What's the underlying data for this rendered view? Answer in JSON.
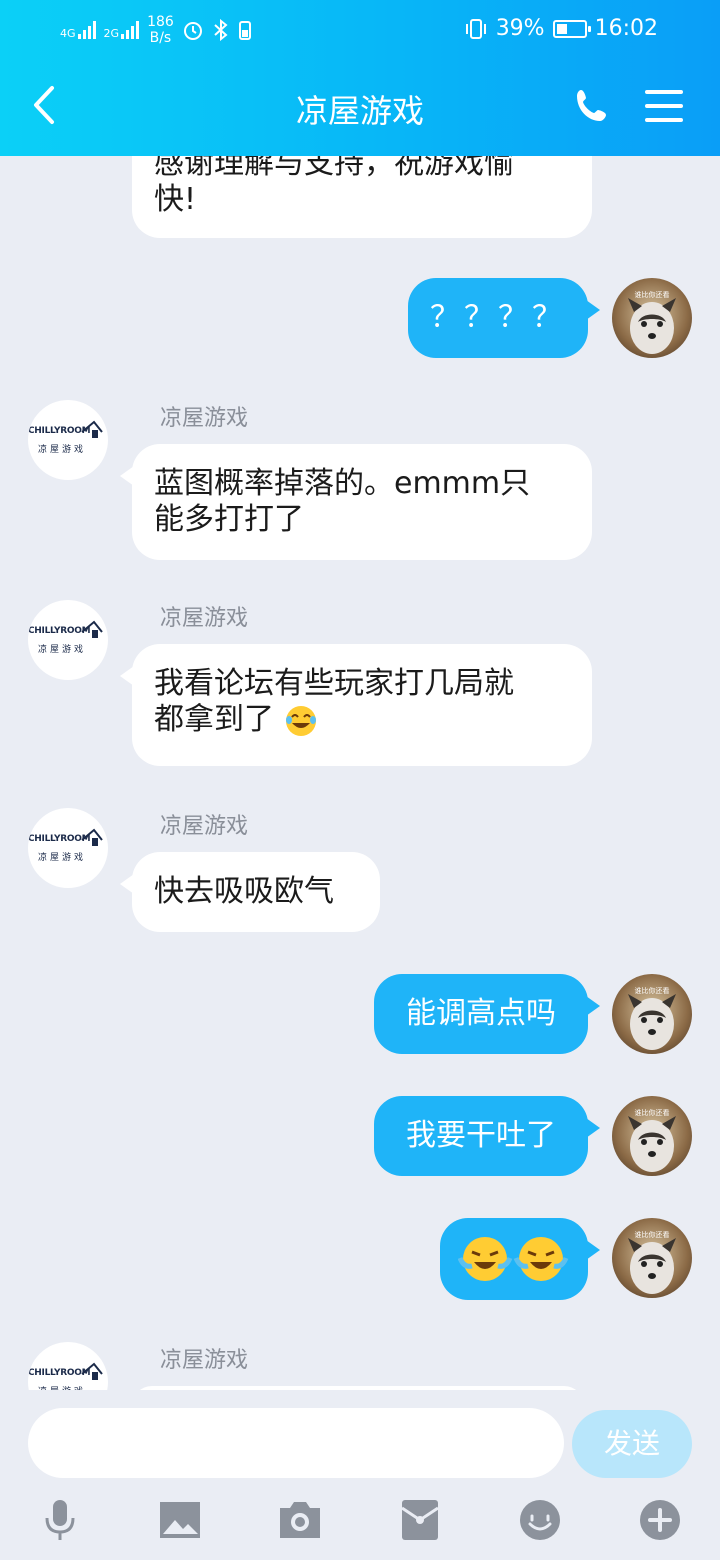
{
  "status_bar": {
    "net1": "4G",
    "net2": "2G",
    "speed": "186",
    "speed_unit": "B/s",
    "battery": "39%",
    "battery_level": 0.39,
    "time": "16:02"
  },
  "header": {
    "title": "凉屋游戏"
  },
  "messages": [
    {
      "dir": "in",
      "text1": "感谢理解与支持，祝游戏愉",
      "text2": "快!"
    },
    {
      "dir": "out",
      "text": "？？？？"
    },
    {
      "dir": "in",
      "sender": "凉屋游戏",
      "text1": "蓝图概率掉落的。emmm只",
      "text2": "能多打打了"
    },
    {
      "dir": "in",
      "sender": "凉屋游戏",
      "text1": "我看论坛有些玩家打几局就",
      "text2": "都拿到了"
    },
    {
      "dir": "in",
      "sender": "凉屋游戏",
      "text": "快去吸吸欧气"
    },
    {
      "dir": "out",
      "text": "能调高点吗"
    },
    {
      "dir": "out",
      "text": "我要干吐了"
    },
    {
      "dir": "out",
      "emoji": "crying-laughing-emoji"
    },
    {
      "dir": "in",
      "sender": "凉屋游戏"
    }
  ],
  "avatars": {
    "me_caption": "谁比你还看",
    "brand_name": "CHILLYROOM",
    "brand_cn": "凉屋游戏"
  },
  "input": {
    "placeholder": "",
    "send_label": "发送"
  },
  "toolbar": [
    "microphone-icon",
    "image-icon",
    "camera-icon",
    "red-packet-icon",
    "emoji-icon",
    "plus-icon"
  ],
  "colors": {
    "header": "#08b6f7",
    "out_bubble": "#1fb4f8",
    "in_bubble": "#ffffff",
    "background": "#eaedf4",
    "send_disabled": "#b8e6fb"
  }
}
